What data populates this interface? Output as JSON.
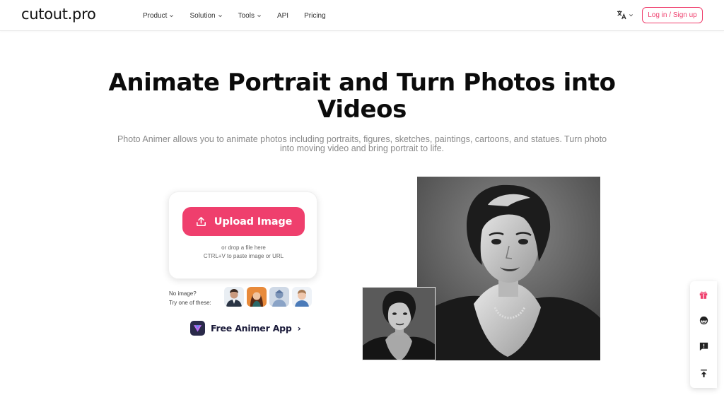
{
  "brand": {
    "logo": "cutout.pro"
  },
  "nav": {
    "items": [
      {
        "label": "Product",
        "dropdown": true
      },
      {
        "label": "Solution",
        "dropdown": true
      },
      {
        "label": "Tools",
        "dropdown": true
      },
      {
        "label": "API",
        "dropdown": false
      },
      {
        "label": "Pricing",
        "dropdown": false
      }
    ],
    "login_label": "Log in / Sign up"
  },
  "hero": {
    "title_line1": "Animate Portrait and Turn Photos into",
    "title_line2": "Videos",
    "subtitle_line1": "Photo Animer allows you to animate photos including portraits, figures, sketches, paintings, cartoons, and statues. Turn photo",
    "subtitle_line2": "into moving video and bring portrait to life."
  },
  "upload": {
    "button_label": "Upload Image",
    "drop_text": "or drop a file here",
    "paste_text": "CTRL+V to paste image or URL"
  },
  "samples": {
    "line1": "No image?",
    "line2": "Try one of these:"
  },
  "app_link": {
    "label": "Free Animer App",
    "arrow": "›"
  },
  "colors": {
    "accent": "#ef3f6d",
    "text_dark": "#0b0b0b",
    "text_muted": "#8a8a8a"
  },
  "icons": {
    "lang": "translate-icon",
    "upload": "upload-icon",
    "gift": "gift-icon",
    "support": "support-agent-icon",
    "feedback": "feedback-icon",
    "top": "back-to-top-icon"
  }
}
